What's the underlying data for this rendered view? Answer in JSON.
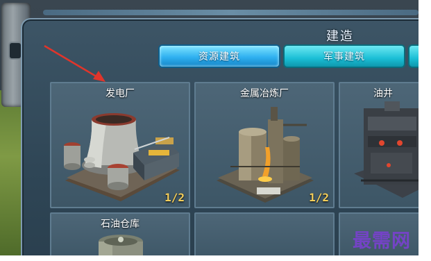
{
  "window": {
    "title": "建造"
  },
  "tabs": [
    {
      "label": "资源建筑",
      "active": true
    },
    {
      "label": "军事建筑",
      "active": false
    }
  ],
  "buildings": [
    {
      "name": "发电厂",
      "count": "1/2",
      "icon": "power-plant-icon"
    },
    {
      "name": "金属冶炼厂",
      "count": "1/2",
      "icon": "metal-smelter-icon"
    },
    {
      "name": "油井",
      "count": "",
      "icon": "oil-well-icon"
    },
    {
      "name": "石油仓库",
      "count": "",
      "icon": "oil-depot-icon"
    },
    {
      "name": "",
      "count": "",
      "icon": ""
    },
    {
      "name": "",
      "count": "",
      "icon": ""
    }
  ],
  "watermark": "最需网",
  "colors": {
    "active_tab": "#2fb0f0",
    "tab": "#1bbfd6",
    "count_text": "#f5cf5a",
    "arrow": "#e0352b"
  }
}
